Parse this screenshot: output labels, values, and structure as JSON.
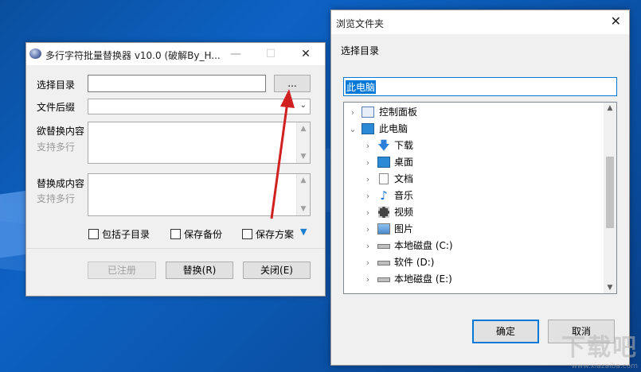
{
  "main_window": {
    "title": "多行字符批量替换器 v10.0 (破解By_H...",
    "minimize": "—",
    "maximize": "☐",
    "close": "✕",
    "dir_label": "选择目录",
    "browse_button": "...",
    "ext_label": "文件后缀",
    "find_label": "欲替换内容",
    "find_hint": "支持多行",
    "replace_label": "替换成内容",
    "replace_hint": "支持多行",
    "checkbox_subdirs": "包括子目录",
    "checkbox_backup": "保存备份",
    "checkbox_scheme": "保存方案",
    "registered_button": "已注册",
    "replace_button": "替换(R)",
    "close_button": "关闭(E)"
  },
  "browse_dialog": {
    "title": "浏览文件夹",
    "prompt": "选择目录",
    "selected_folder": "此电脑",
    "tree": [
      {
        "label": "控制面板",
        "icon": "control-panel-icon",
        "expanded": false
      },
      {
        "label": "此电脑",
        "icon": "computer-icon",
        "expanded": true
      },
      {
        "label": "下载",
        "icon": "download-icon",
        "expanded": false
      },
      {
        "label": "桌面",
        "icon": "desktop-icon",
        "expanded": false
      },
      {
        "label": "文档",
        "icon": "document-icon",
        "expanded": false
      },
      {
        "label": "音乐",
        "icon": "music-icon",
        "expanded": false
      },
      {
        "label": "视频",
        "icon": "video-icon",
        "expanded": false
      },
      {
        "label": "图片",
        "icon": "picture-icon",
        "expanded": false
      },
      {
        "label": "本地磁盘 (C:)",
        "icon": "drive-icon",
        "expanded": false
      },
      {
        "label": "软件 (D:)",
        "icon": "drive-icon",
        "expanded": false
      },
      {
        "label": "本地磁盘 (E:)",
        "icon": "drive-icon",
        "expanded": false
      }
    ],
    "ok_button": "确定",
    "cancel_button": "取消"
  },
  "watermark": {
    "main": "下载吧",
    "sub": "www.xiazaiba.com"
  }
}
